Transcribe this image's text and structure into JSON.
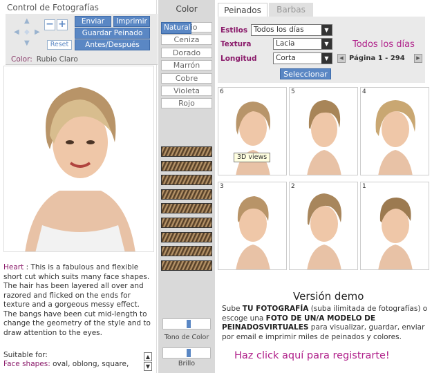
{
  "left": {
    "title": "Control de Fotografías",
    "buttons": {
      "enviar": "Enviar",
      "imprimir": "Imprimir",
      "guardar": "Guardar Peinado",
      "antes": "Antes/Después",
      "reset": "Reset",
      "minus": "−",
      "plus": "+"
    },
    "color_label": "Color:",
    "color_value": "Rubio Claro",
    "desc_name": "Heart",
    "desc_text": " : This is a fabulous and flexible short cut which suits many face shapes. The hair has been layered all over and razored and flicked on the ends for texture and a gorgeous messy effect. The bangs have been cut mid-length to change the geometry of the style and to draw attention to the eyes.",
    "suitable_label": "Suitable for:",
    "face_label": "Face shapes:",
    "face_value": " oval, oblong, square,"
  },
  "colors": {
    "header": "Color",
    "items": [
      "Natural",
      "Rubio",
      "Ceniza",
      "Dorado",
      "Marrón",
      "Cobre",
      "Violeta",
      "Rojo"
    ],
    "selected": "Natural",
    "tone_label": "Tono de Color",
    "bright_label": "Brillo",
    "tone_level": 0.55,
    "bright_level": 0.55
  },
  "right": {
    "tab_active": "Peinados",
    "tab_inactive": "Barbas",
    "estilos_label": "Estilos",
    "estilos_value": "Todos los días",
    "textura_label": "Textura",
    "textura_value": "Lacia",
    "longitud_label": "Longitud",
    "longitud_value": "Corta",
    "todos": "Todos los días",
    "pagina": "Página 1  -  294",
    "seleccionar": "Seleccionar",
    "cells": [
      "6",
      "5",
      "4",
      "3",
      "2",
      "1"
    ],
    "tooltip": "3D views",
    "version": "Versión demo",
    "demo_sube": "Sube ",
    "demo_tu": "TU FOTOGRAFÍA",
    "demo_mid": "  (suba ilimitada de fotografías) o escoge una ",
    "demo_foto": "FOTO DE UN/A MODELO DE PEINADOSVIRTUALES",
    "demo_end": " para visualizar, guardar, enviar por email e imprimir miles de peinados y colores.",
    "cta": "Haz click aquí para registrarte!"
  }
}
